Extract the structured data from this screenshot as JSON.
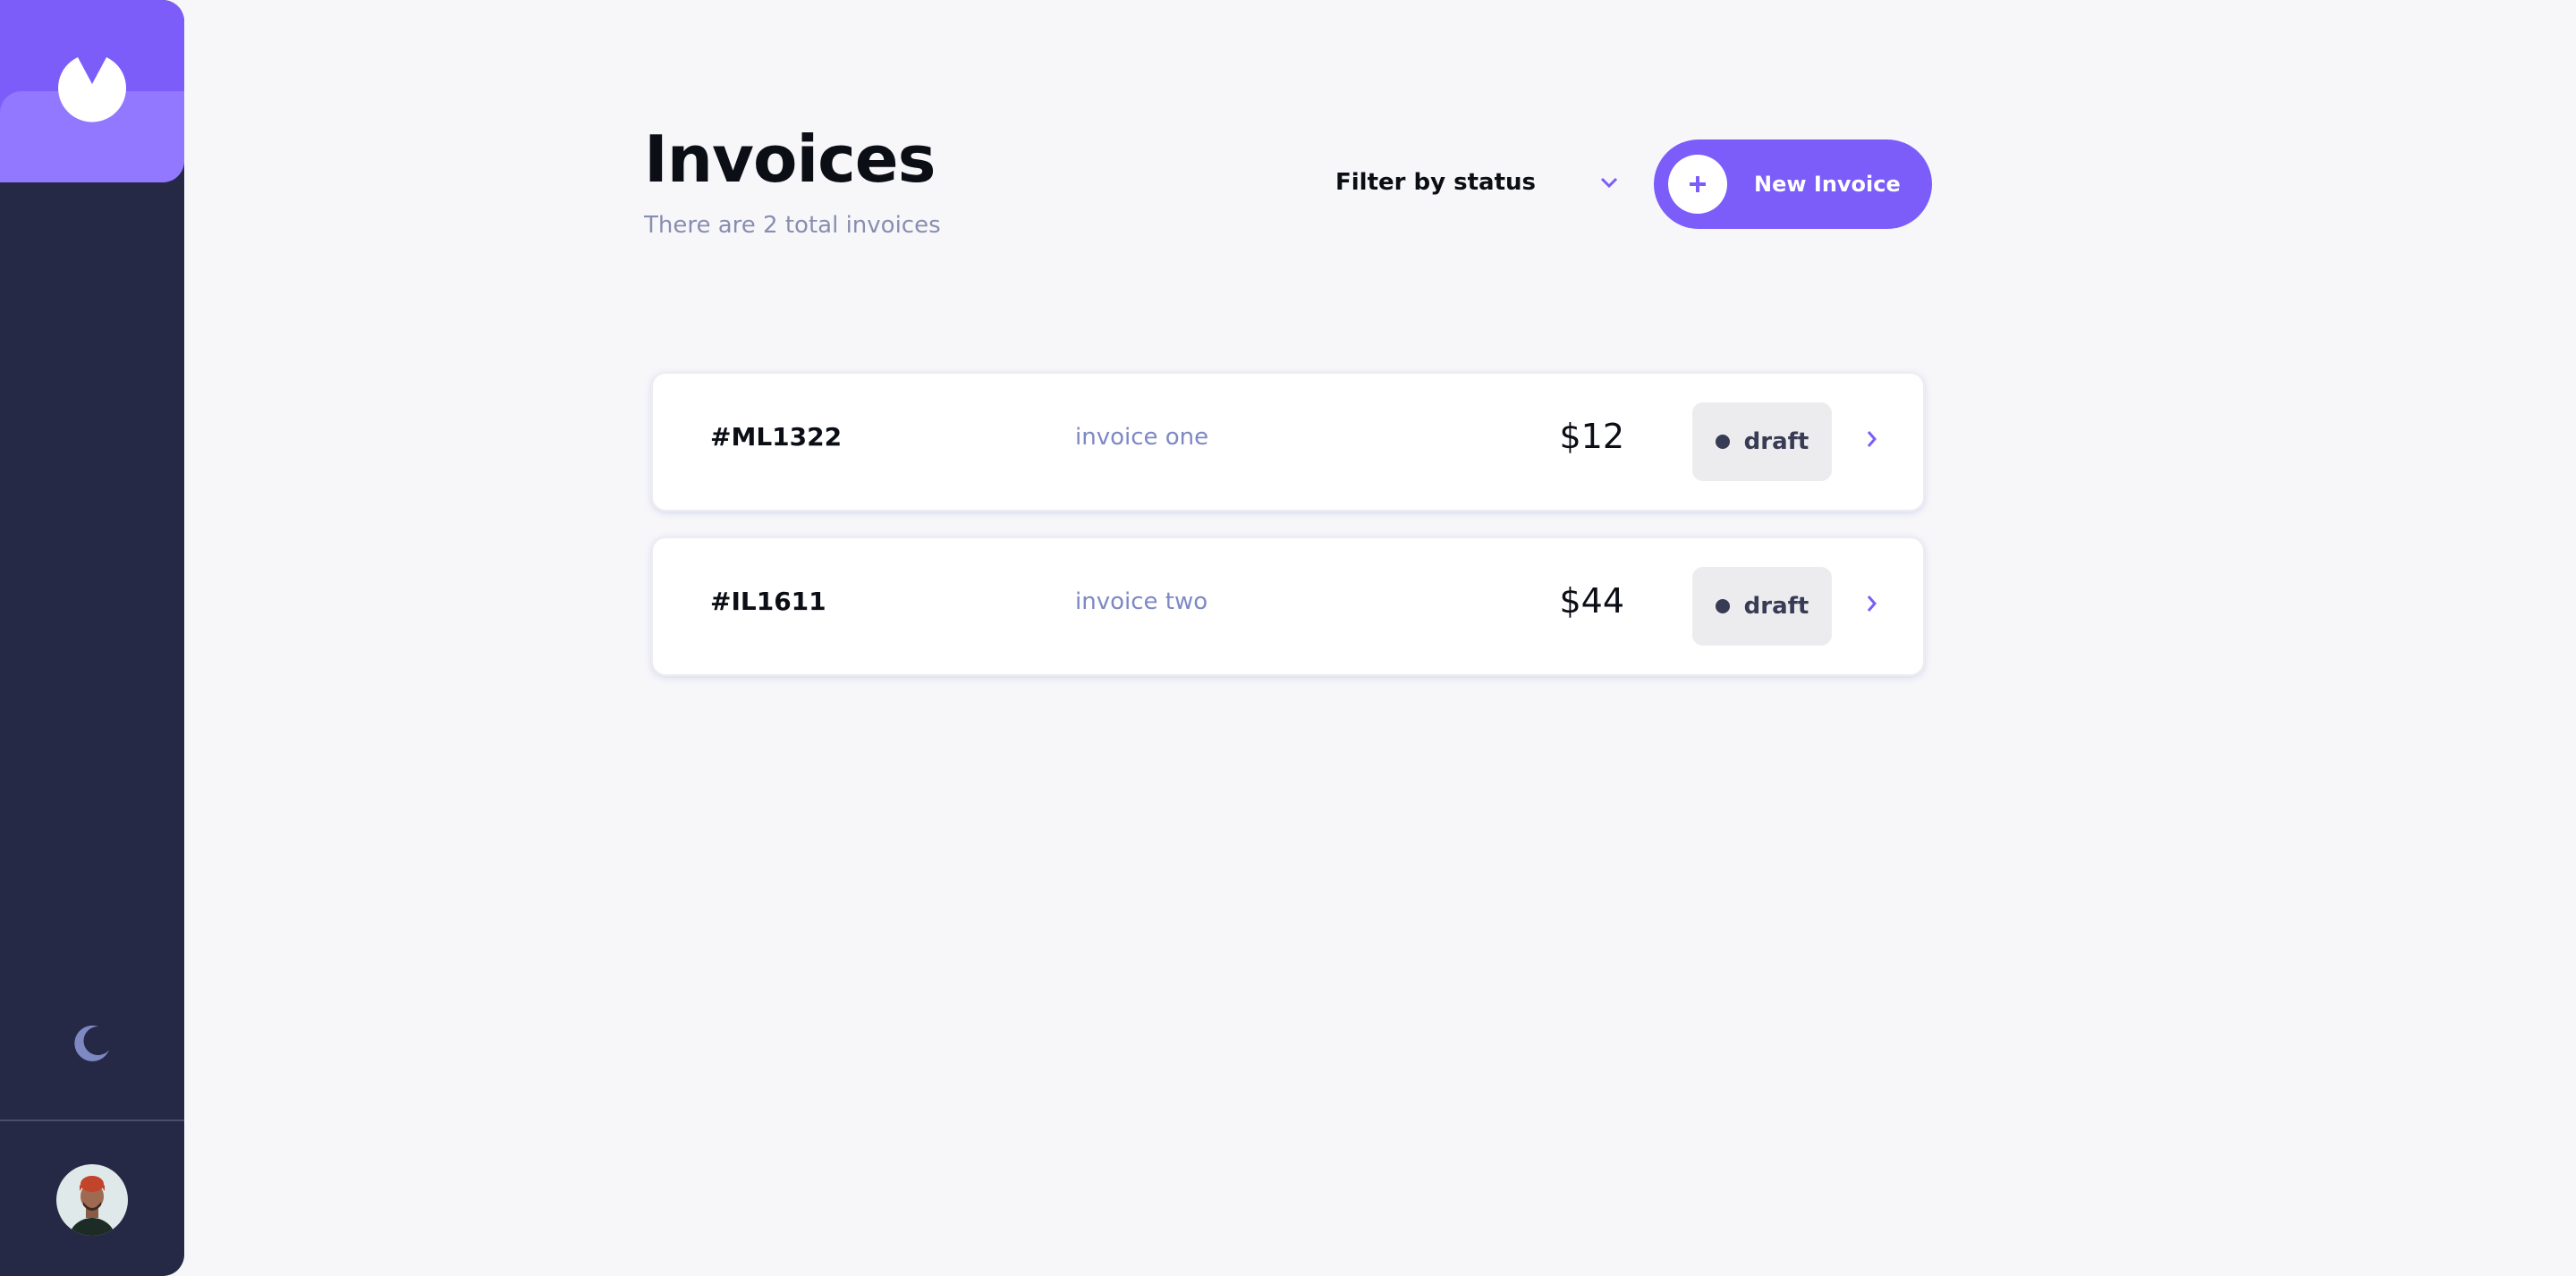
{
  "sidebar": {
    "logo_icon": "brand-logo-icon",
    "theme_icon": "moon-icon",
    "avatar_icon": "user-avatar",
    "brand_color": "#7c5dfa"
  },
  "header": {
    "title": "Invoices",
    "subtitle": "There are 2 total invoices",
    "filter_label": "Filter by status",
    "new_button_label": "New Invoice"
  },
  "invoices": [
    {
      "id": "#ML1322",
      "name": "invoice one",
      "amount": "$12",
      "status": "draft"
    },
    {
      "id": "#IL1611",
      "name": "invoice two",
      "amount": "$44",
      "status": "draft"
    }
  ],
  "colors": {
    "accent": "#7c5dfa",
    "sidebar": "#252945",
    "background": "#f7f7fa",
    "draft_badge_bg": "#ececef",
    "draft_badge_text": "#373b53"
  }
}
